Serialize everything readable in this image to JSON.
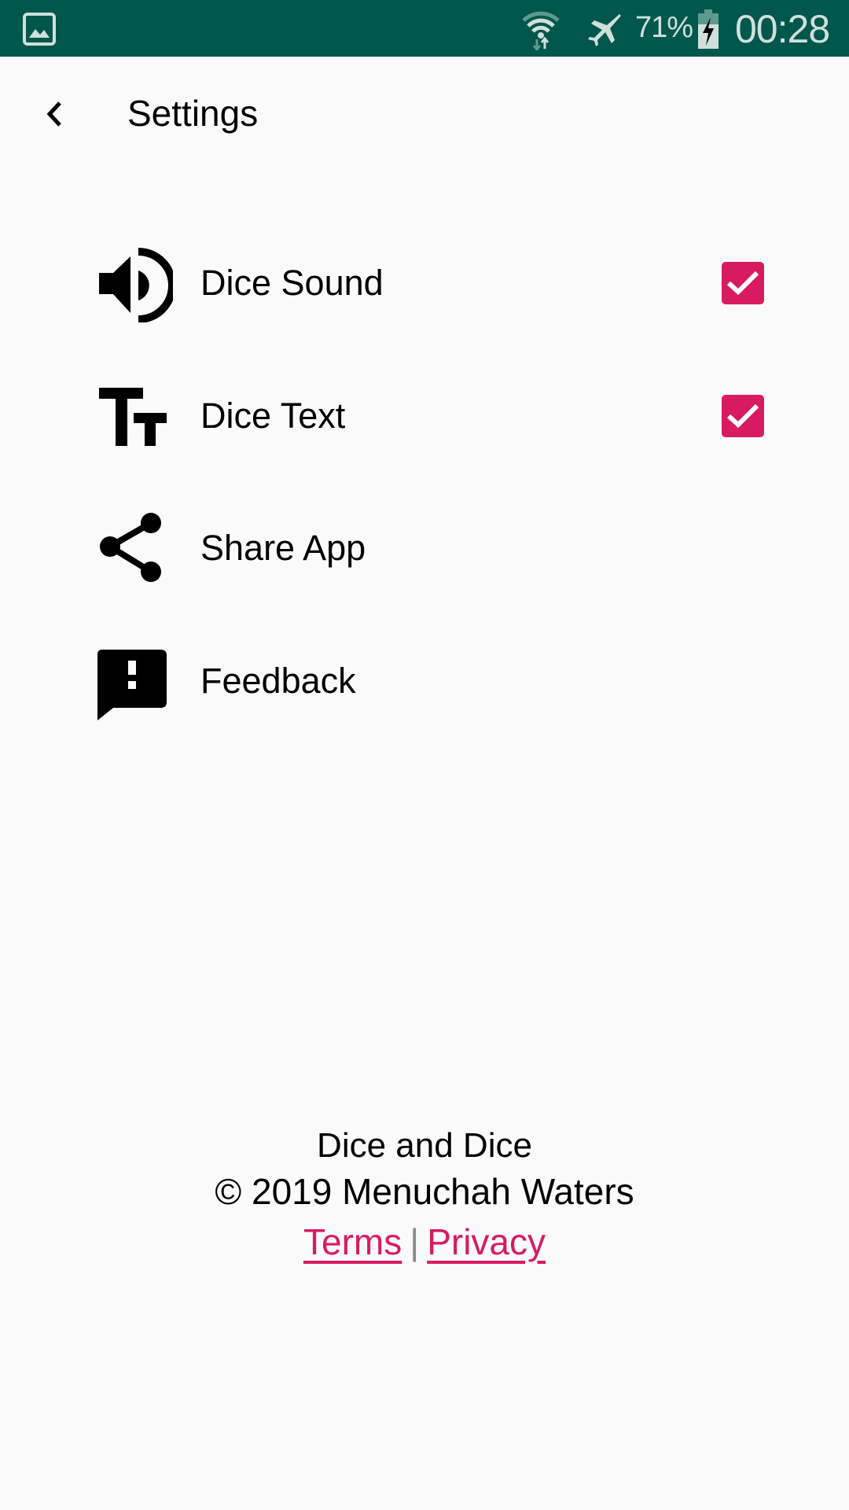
{
  "status_bar": {
    "left_icon": "gallery-notification-icon",
    "wifi_icon": "wifi-icon",
    "airplane_icon": "airplane-mode-icon",
    "battery_percent": "71%",
    "battery_icon": "battery-charging-icon",
    "time": "00:28"
  },
  "app_bar": {
    "back_icon": "back-arrow-icon",
    "title": "Settings"
  },
  "settings": {
    "items": [
      {
        "icon": "volume-up-icon",
        "label": "Dice Sound",
        "checkbox": true,
        "checked": true
      },
      {
        "icon": "text-fields-icon",
        "label": "Dice Text",
        "checkbox": true,
        "checked": true
      },
      {
        "icon": "share-icon",
        "label": "Share App",
        "checkbox": false
      },
      {
        "icon": "feedback-icon",
        "label": "Feedback",
        "checkbox": false
      }
    ]
  },
  "footer": {
    "app_name": "Dice and Dice",
    "copyright": "© 2019 Menuchah Waters",
    "terms_label": "Terms",
    "separator": "|",
    "privacy_label": "Privacy"
  },
  "colors": {
    "status_bar": "#00574B",
    "accent": "#D81B60",
    "background": "#FAFAFA"
  }
}
